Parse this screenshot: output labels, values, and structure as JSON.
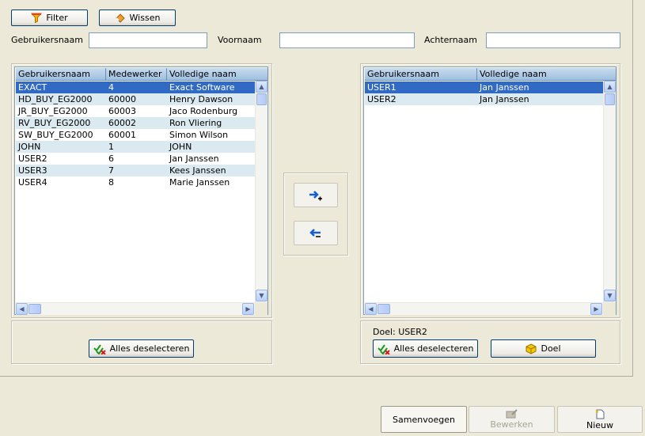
{
  "toolbar": {
    "filter_label": "Filter",
    "wissen_label": "Wissen"
  },
  "filters": {
    "gebruikersnaam_label": "Gebruikersnaam",
    "voornaam_label": "Voornaam",
    "achternaam_label": "Achternaam",
    "gebruikersnaam_value": "",
    "voornaam_value": "",
    "achternaam_value": ""
  },
  "left_grid": {
    "columns": [
      "Gebruikersnaam",
      "Medewerker",
      "Volledige naam"
    ],
    "rows": [
      [
        "EXACT",
        "4",
        "Exact Software"
      ],
      [
        "HD_BUY_EG2000",
        "60000",
        "Henry Dawson"
      ],
      [
        "JR_BUY_EG2000",
        "60003",
        "Jaco Rodenburg"
      ],
      [
        "RV_BUY_EG2000",
        "60002",
        "Ron Vliering"
      ],
      [
        "SW_BUY_EG2000",
        "60001",
        "Simon Wilson"
      ],
      [
        "JOHN",
        "1",
        "JOHN"
      ],
      [
        "USER2",
        "6",
        "Jan Janssen"
      ],
      [
        "USER3",
        "7",
        "Kees Janssen"
      ],
      [
        "USER4",
        "8",
        "Marie Janssen"
      ]
    ],
    "selected_index": 0,
    "deselect_label": "Alles deselecteren"
  },
  "right_grid": {
    "columns": [
      "Gebruikersnaam",
      "Volledige naam"
    ],
    "rows": [
      [
        "USER1",
        "Jan Janssen"
      ],
      [
        "USER2",
        "Jan Janssen"
      ]
    ],
    "selected_index": 0,
    "doel_text": "Doel: USER2",
    "deselect_label": "Alles deselecteren",
    "doel_label": "Doel"
  },
  "actions": {
    "samenvoegen_label": "Samenvoegen",
    "bewerken_label": "Bewerken",
    "nieuw_label": "Nieuw"
  },
  "icons": {
    "filter": "funnel-icon",
    "wissen": "eraser-icon",
    "add": "arrow-right-plus-icon",
    "remove": "arrow-left-minus-icon",
    "deselect": "deselect-check-icon",
    "doel": "cube-icon",
    "bewerken": "edit-icon",
    "nieuw": "new-document-icon"
  },
  "colors": {
    "background": "#ece9d8",
    "selection": "#316ac5",
    "alt_row": "#dbeaf0"
  }
}
